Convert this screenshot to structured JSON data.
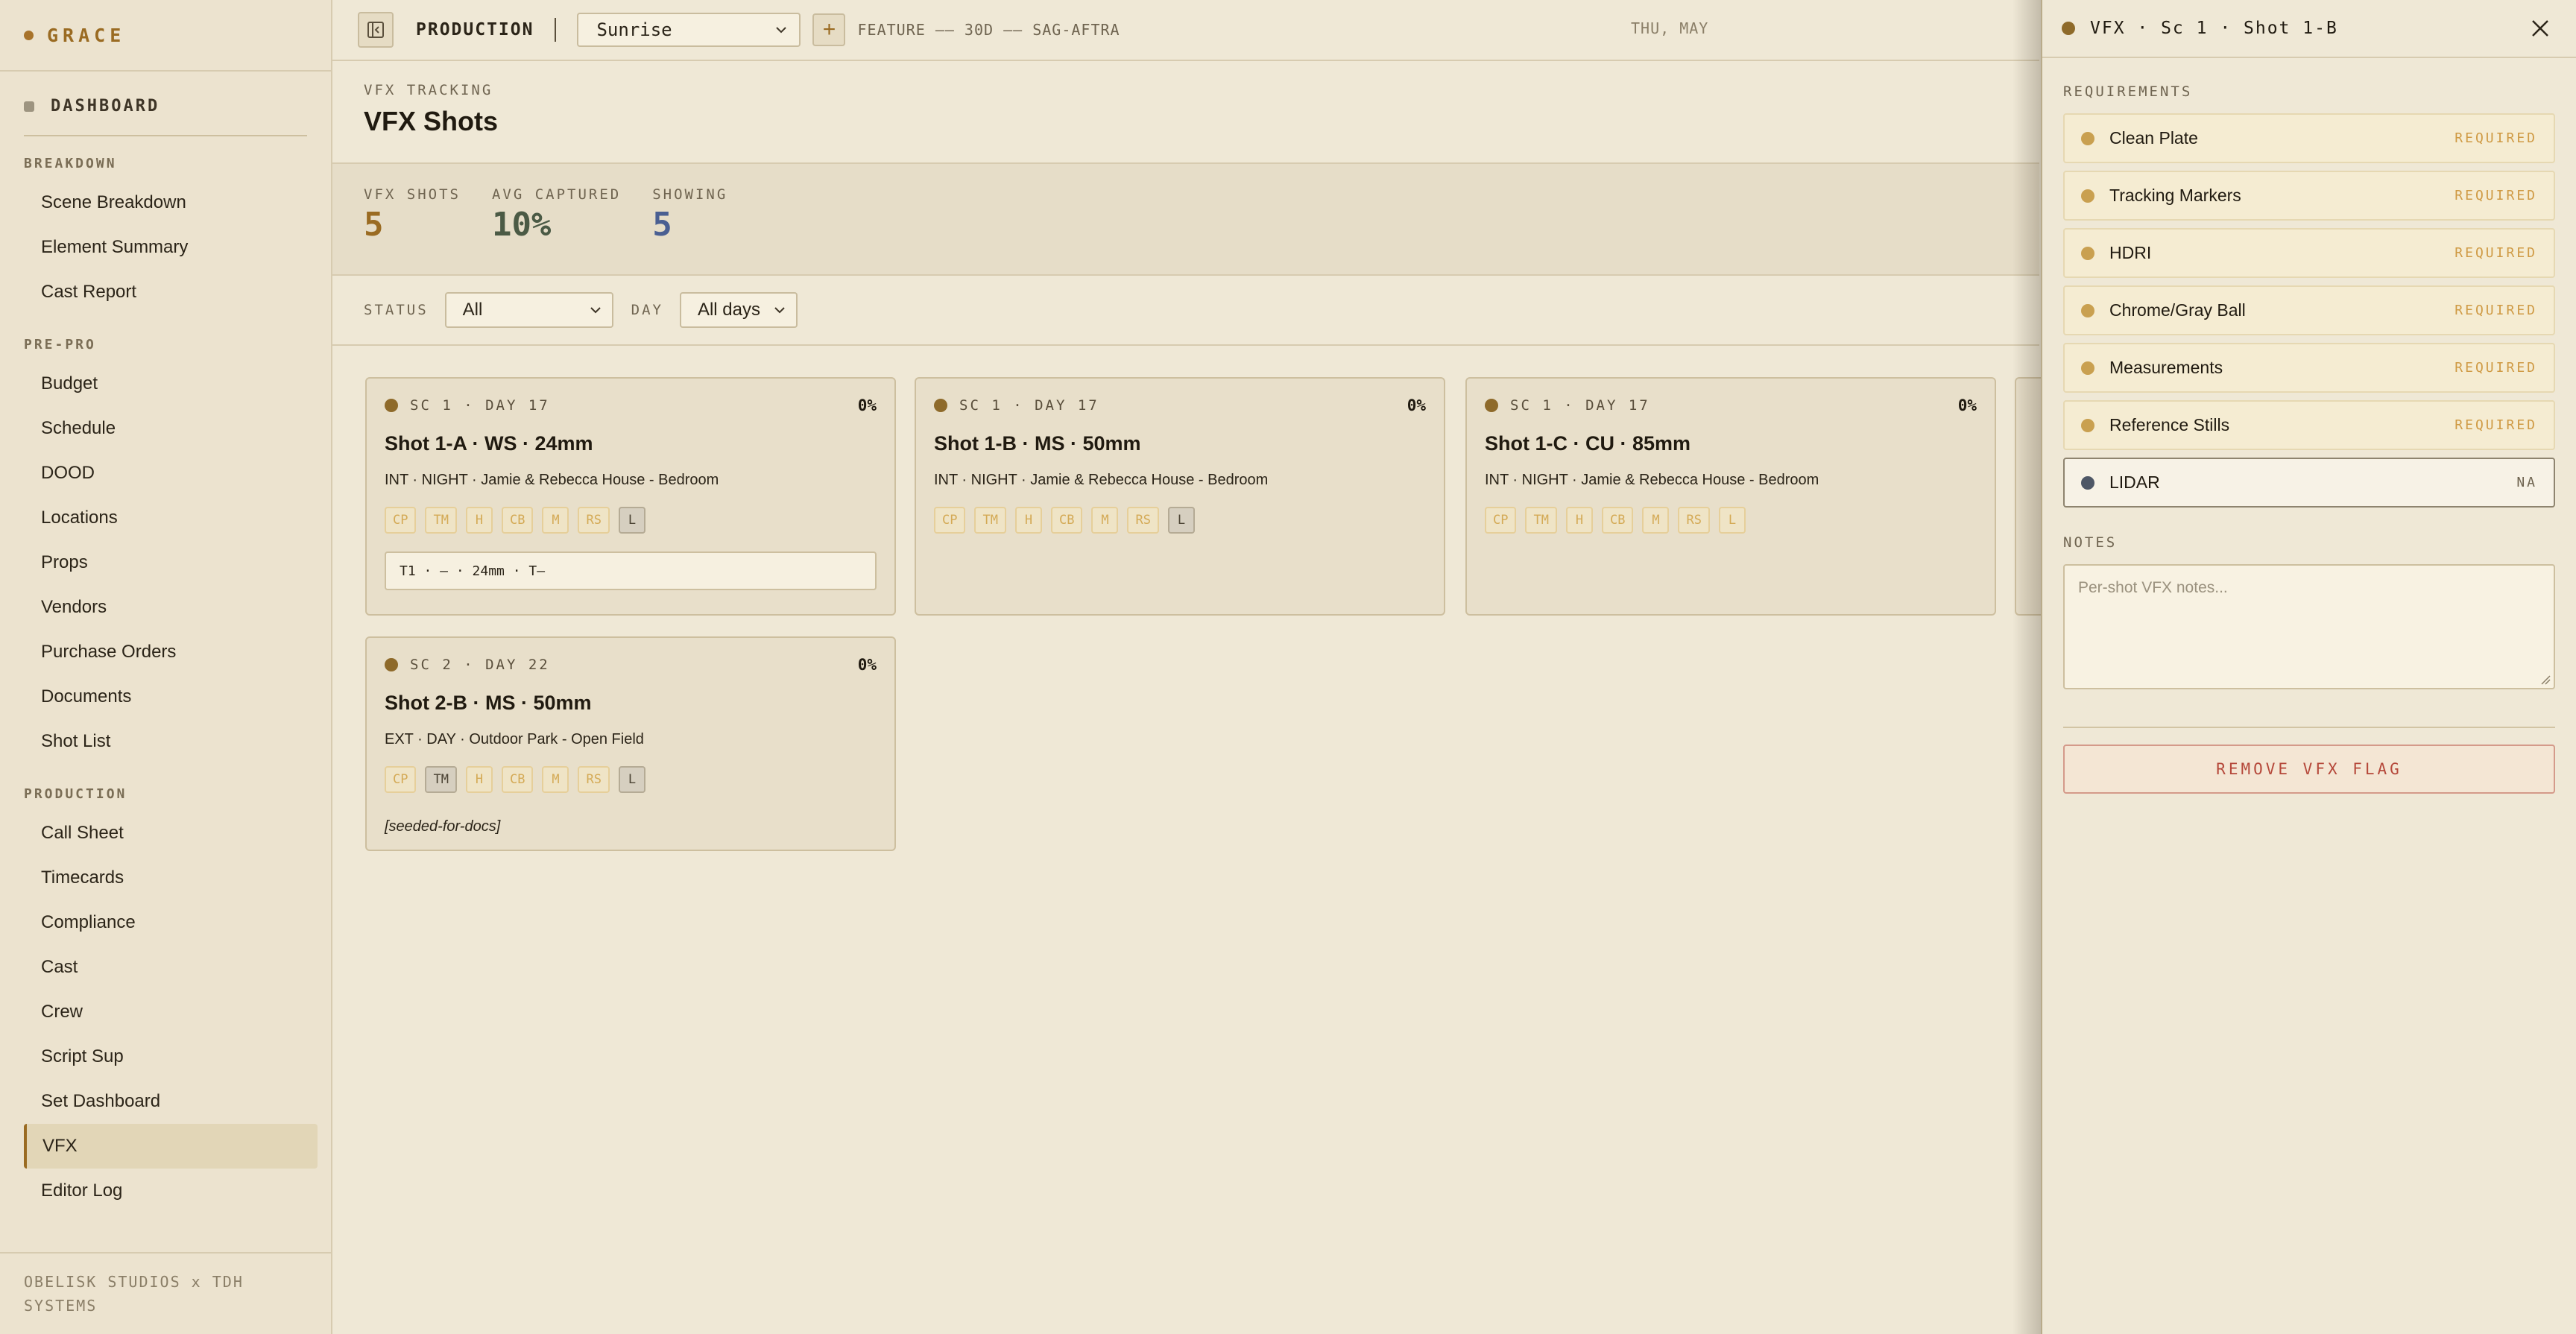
{
  "app": {
    "brand": "GRACE"
  },
  "sidebar": {
    "dashboard": "DASHBOARD",
    "sections": [
      {
        "label": "BREAKDOWN",
        "items": [
          "Scene Breakdown",
          "Element Summary",
          "Cast Report"
        ]
      },
      {
        "label": "PRE-PRO",
        "items": [
          "Budget",
          "Schedule",
          "DOOD",
          "Locations",
          "Props",
          "Vendors",
          "Purchase Orders",
          "Documents",
          "Shot List"
        ]
      },
      {
        "label": "PRODUCTION",
        "items": [
          "Call Sheet",
          "Timecards",
          "Compliance",
          "Cast",
          "Crew",
          "Script Sup",
          "Set Dashboard",
          "VFX",
          "Editor Log"
        ]
      }
    ],
    "active": "VFX",
    "footer": "OBELISK STUDIOS x TDH SYSTEMS"
  },
  "topbar": {
    "title": "PRODUCTION",
    "project": "Sunrise",
    "meta": "FEATURE —— 30D —— SAG-AFTRA",
    "date": "THU, MAY"
  },
  "page": {
    "eyebrow": "VFX TRACKING",
    "title": "VFX Shots"
  },
  "stats": [
    {
      "label": "VFX SHOTS",
      "value": "5",
      "color": "#9a6b22"
    },
    {
      "label": "AVG CAPTURED",
      "value": "10%",
      "color": "#4b5a45"
    },
    {
      "label": "SHOWING",
      "value": "5",
      "color": "#4a5f92"
    }
  ],
  "filters": {
    "status_label": "STATUS",
    "status_value": "All",
    "day_label": "DAY",
    "day_value": "All days"
  },
  "cards": [
    {
      "meta": "SC 1 · DAY 17",
      "pct": "0%",
      "title": "Shot 1-A · WS · 24mm",
      "loc": "INT · NIGHT · Jamie & Rebecca House - Bedroom",
      "chips": [
        {
          "t": "CP",
          "na": false
        },
        {
          "t": "TM",
          "na": false
        },
        {
          "t": "H",
          "na": false
        },
        {
          "t": "CB",
          "na": false
        },
        {
          "t": "M",
          "na": false
        },
        {
          "t": "RS",
          "na": false
        },
        {
          "t": "L",
          "na": true
        }
      ],
      "lens": "T1 · — · 24mm · T—",
      "note": ""
    },
    {
      "meta": "SC 1 · DAY 17",
      "pct": "0%",
      "title": "Shot 1-B · MS · 50mm",
      "loc": "INT · NIGHT · Jamie & Rebecca House - Bedroom",
      "chips": [
        {
          "t": "CP",
          "na": false
        },
        {
          "t": "TM",
          "na": false
        },
        {
          "t": "H",
          "na": false
        },
        {
          "t": "CB",
          "na": false
        },
        {
          "t": "M",
          "na": false
        },
        {
          "t": "RS",
          "na": false
        },
        {
          "t": "L",
          "na": true
        }
      ],
      "lens": "",
      "note": ""
    },
    {
      "meta": "SC 1 · DAY 17",
      "pct": "0%",
      "title": "Shot 1-C · CU · 85mm",
      "loc": "INT · NIGHT · Jamie & Rebecca House - Bedroom",
      "chips": [
        {
          "t": "CP",
          "na": false
        },
        {
          "t": "TM",
          "na": false
        },
        {
          "t": "H",
          "na": false
        },
        {
          "t": "CB",
          "na": false
        },
        {
          "t": "M",
          "na": false
        },
        {
          "t": "RS",
          "na": false
        },
        {
          "t": "L",
          "na": false
        }
      ],
      "lens": "",
      "note": ""
    },
    {
      "meta": "SC 2 · DAY 22",
      "pct": "0%",
      "title": "Shot 2-B · MS · 50mm",
      "loc": "EXT · DAY · Outdoor Park - Open Field",
      "chips": [
        {
          "t": "CP",
          "na": false
        },
        {
          "t": "TM",
          "na": true
        },
        {
          "t": "H",
          "na": false
        },
        {
          "t": "CB",
          "na": false
        },
        {
          "t": "M",
          "na": false
        },
        {
          "t": "RS",
          "na": false
        },
        {
          "t": "L",
          "na": true
        }
      ],
      "lens": "",
      "note": "[seeded-for-docs]"
    }
  ],
  "panel": {
    "title": "VFX · Sc 1 · Shot 1-B",
    "requirements_label": "REQUIREMENTS",
    "requirements": [
      {
        "name": "Clean Plate",
        "state": "REQUIRED",
        "na": false
      },
      {
        "name": "Tracking Markers",
        "state": "REQUIRED",
        "na": false
      },
      {
        "name": "HDRI",
        "state": "REQUIRED",
        "na": false
      },
      {
        "name": "Chrome/Gray Ball",
        "state": "REQUIRED",
        "na": false
      },
      {
        "name": "Measurements",
        "state": "REQUIRED",
        "na": false
      },
      {
        "name": "Reference Stills",
        "state": "REQUIRED",
        "na": false
      },
      {
        "name": "LIDAR",
        "state": "NA",
        "na": true
      }
    ],
    "notes_label": "NOTES",
    "notes_placeholder": "Per-shot VFX notes...",
    "remove_label": "REMOVE VFX FLAG"
  }
}
